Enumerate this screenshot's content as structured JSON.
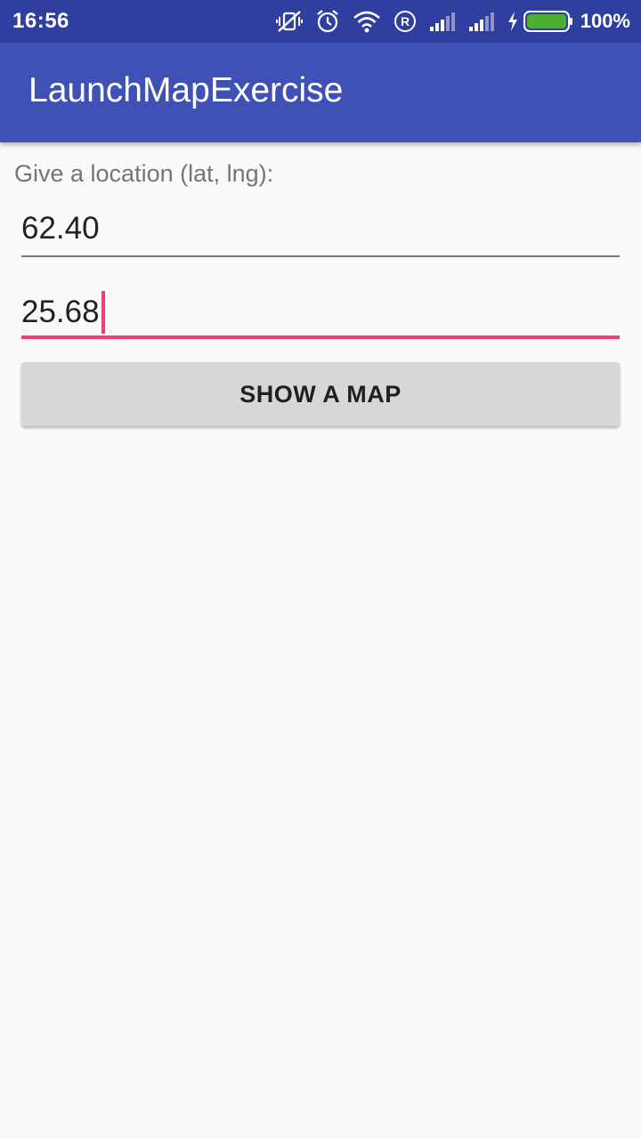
{
  "status_bar": {
    "time": "16:56",
    "battery_text": "100%",
    "icons": [
      "vibrate-off-icon",
      "alarm-icon",
      "wifi-icon",
      "roaming-r-icon",
      "signal-icon",
      "signal-icon",
      "charging-bolt-icon",
      "battery-icon"
    ],
    "battery_color": "#4caf2f"
  },
  "app_bar": {
    "title": "LaunchMapExercise",
    "color": "#3f51b5"
  },
  "form": {
    "prompt": "Give a location (lat, lng):",
    "latitude": {
      "value": "62.40"
    },
    "longitude": {
      "value": "25.68",
      "focused": true
    },
    "show_map_label": "SHOW A MAP"
  },
  "colors": {
    "accent": "#ec407a",
    "status_bar": "#303f9f",
    "background": "#fafafa"
  }
}
